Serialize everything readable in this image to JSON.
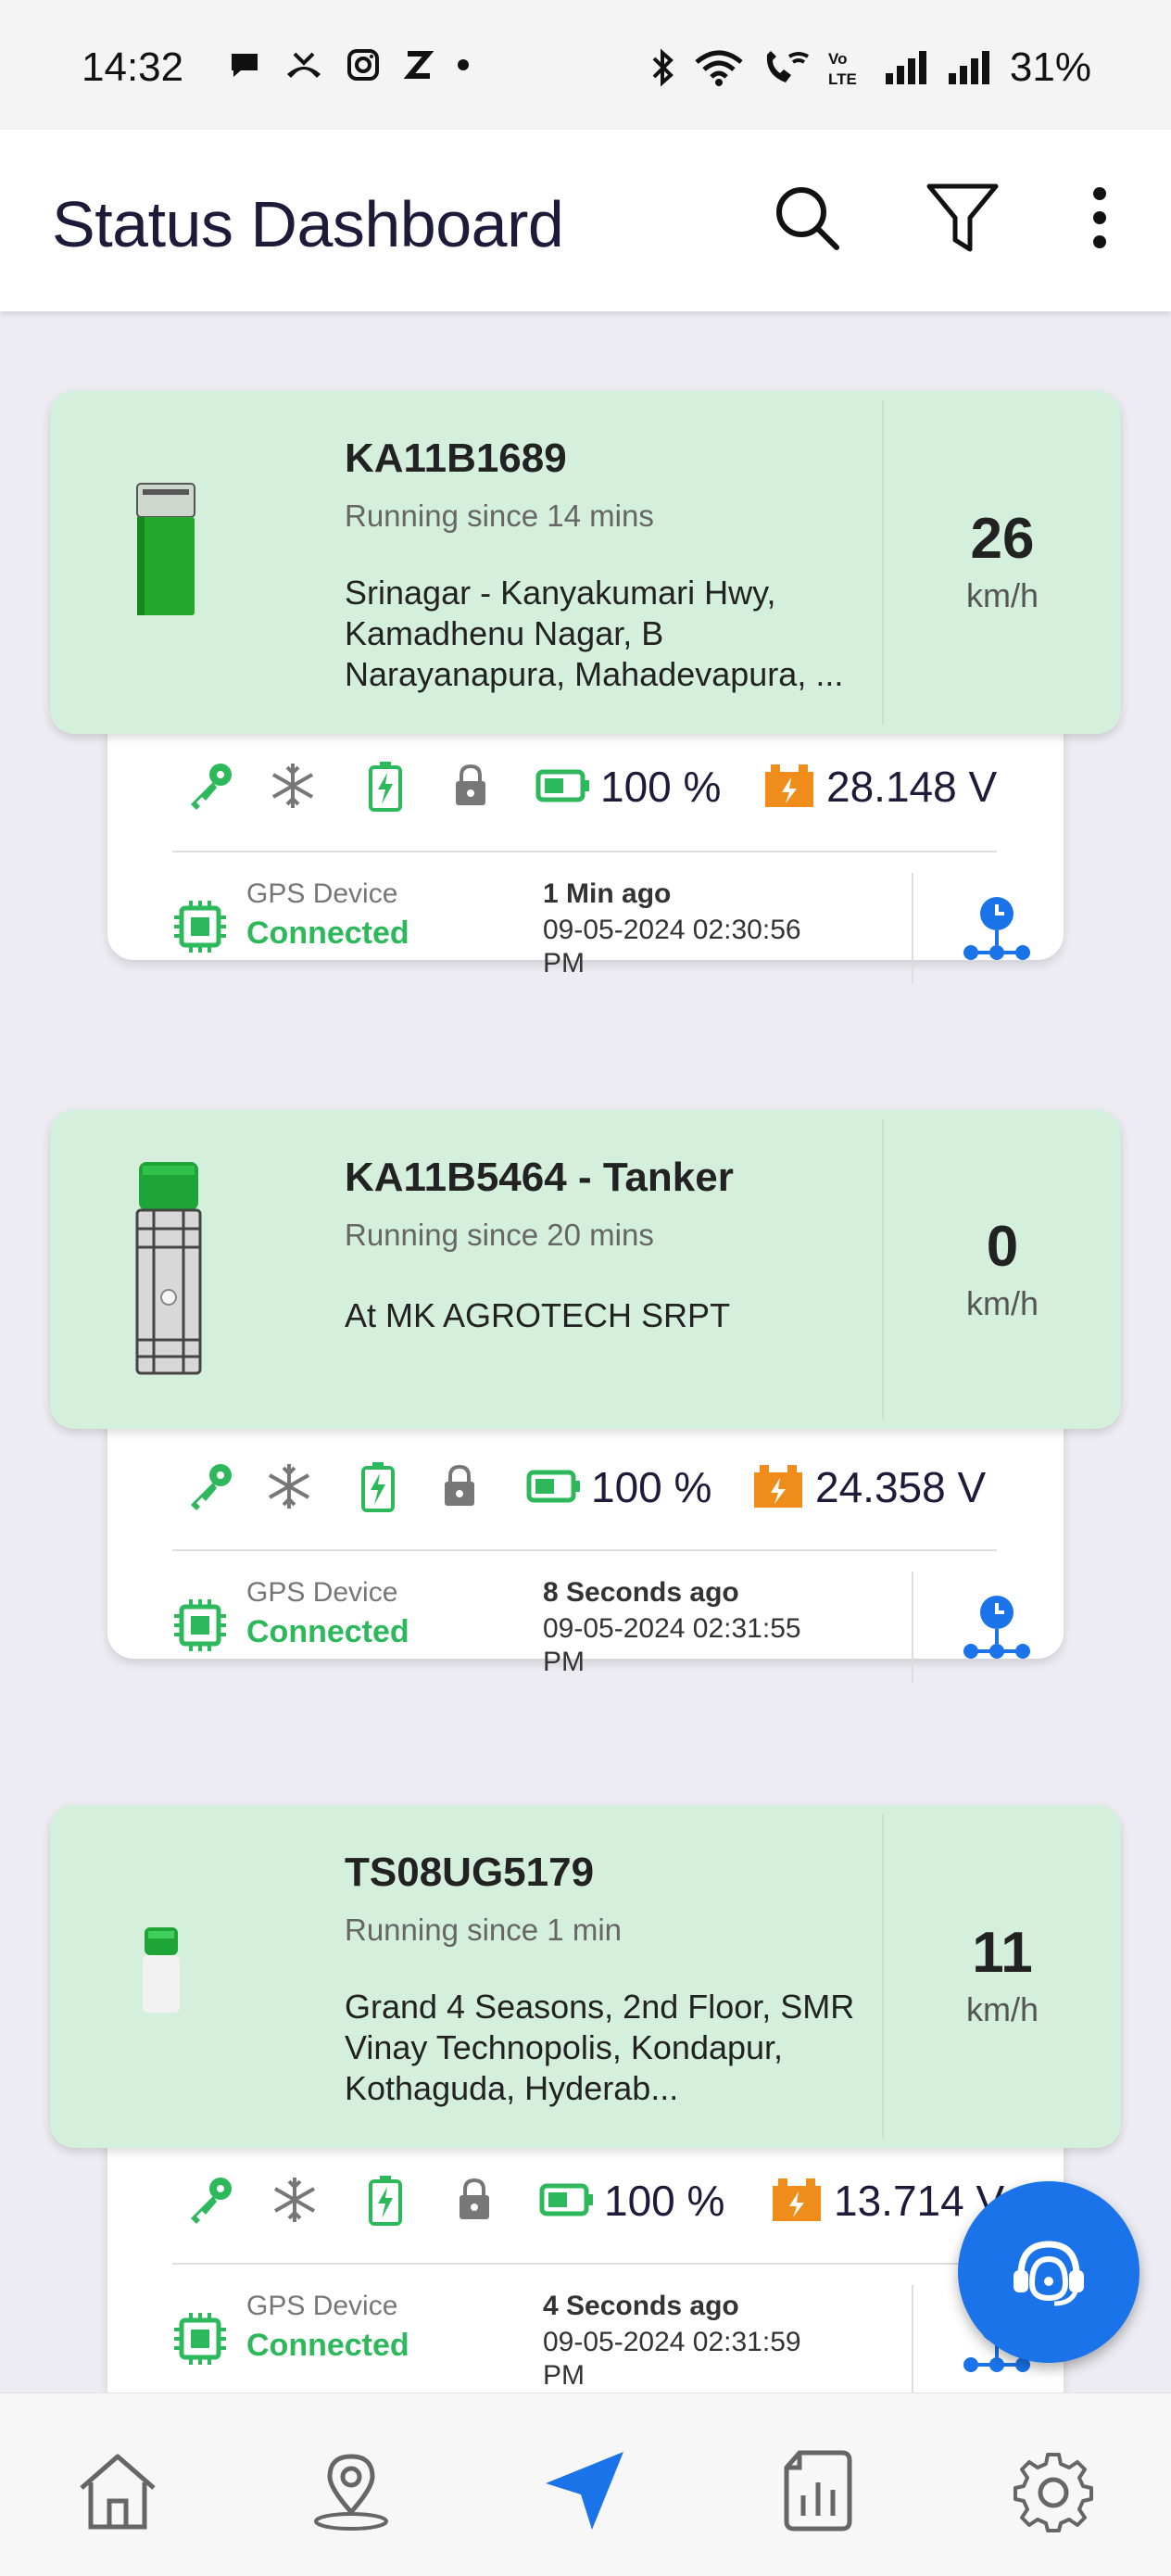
{
  "status_bar": {
    "time": "14:32",
    "battery_percent": "31%",
    "left_icons": [
      "chat-icon",
      "missed-call-icon",
      "instagram-icon",
      "z-icon",
      "dot-icon"
    ],
    "right_icons": [
      "bluetooth-icon",
      "wifi-icon",
      "wifi-call-icon",
      "volte-icon",
      "signal-icon",
      "signal-icon"
    ]
  },
  "app_bar": {
    "title": "Status Dashboard",
    "icons": [
      "search-icon",
      "filter-icon",
      "more-vert-icon"
    ]
  },
  "vehicles": [
    {
      "name": "KA11B1689",
      "status": "Running since 14 mins",
      "address": "Srinagar - Kanyakumari Hwy, Kamadhenu Nagar, B Narayanapura, Mahadevapura, ...",
      "speed": "26",
      "speed_unit": "km/h",
      "battery": "100 %",
      "voltage": "28.148  V",
      "gps_label": "GPS Device",
      "gps_status": "Connected",
      "last_update": "1 Min ago",
      "timestamp": "09-05-2024 02:30:56 PM",
      "vehicle_icon": "truck-green-icon"
    },
    {
      "name": "KA11B5464 - Tanker",
      "status": "Running since 20 mins",
      "address": "At MK AGROTECH SRPT",
      "speed": "0",
      "speed_unit": "km/h",
      "battery": "100 %",
      "voltage": "24.358  V",
      "gps_label": "GPS Device",
      "gps_status": "Connected",
      "last_update": "8 Seconds ago",
      "timestamp": "09-05-2024 02:31:55 PM",
      "vehicle_icon": "tanker-icon"
    },
    {
      "name": "TS08UG5179",
      "status": "Running since 1 min",
      "address": "Grand 4 Seasons, 2nd Floor, SMR Vinay Technopolis, Kondapur, Kothaguda, Hyderab...",
      "speed": "11",
      "speed_unit": "km/h",
      "battery": "100 %",
      "voltage": "13.714  V",
      "gps_label": "GPS Device",
      "gps_status": "Connected",
      "last_update": "4 Seconds ago",
      "timestamp": "09-05-2024 02:31:59 PM",
      "vehicle_icon": "van-icon"
    }
  ],
  "fab": {
    "icon": "support-agent-icon"
  },
  "bottom_nav": [
    "home-icon",
    "location-pin-icon",
    "navigation-arrow-icon",
    "report-icon",
    "settings-icon"
  ],
  "colors": {
    "card_green": "#d5efdd",
    "accent_blue": "#1a73e8",
    "status_green": "#2eb85c",
    "voltage_orange": "#f08c1a"
  }
}
